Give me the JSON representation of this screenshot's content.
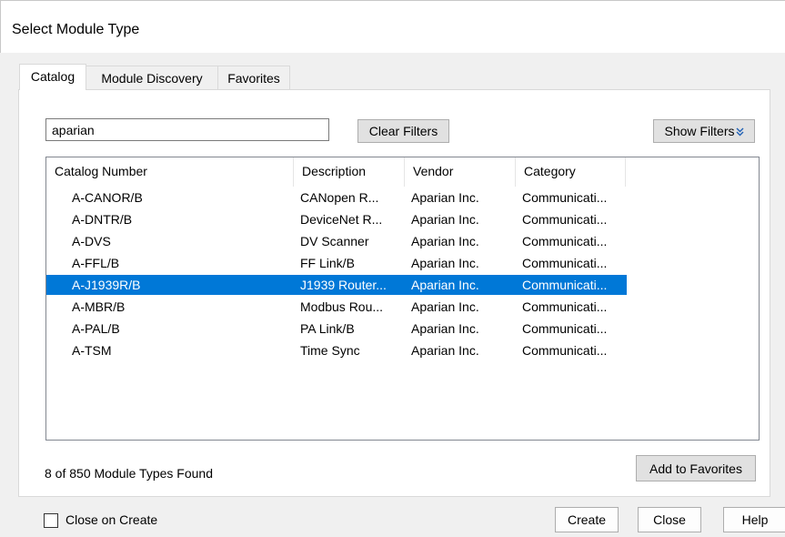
{
  "window": {
    "title": "Select Module Type"
  },
  "tabs": [
    {
      "label": "Catalog",
      "active": true
    },
    {
      "label": "Module Discovery",
      "active": false
    },
    {
      "label": "Favorites",
      "active": false
    }
  ],
  "filters": {
    "search_value": "aparian",
    "clear_filters_label": "Clear Filters",
    "show_filters_label": "Show Filters",
    "show_filters_icon": "double-chevron-down-icon"
  },
  "table": {
    "columns": [
      "Catalog Number",
      "Description",
      "Vendor",
      "Category"
    ],
    "rows": [
      {
        "catalog": "A-CANOR/B",
        "description": "CANopen R...",
        "vendor": "Aparian Inc.",
        "category": "Communicati..."
      },
      {
        "catalog": "A-DNTR/B",
        "description": "DeviceNet R...",
        "vendor": "Aparian Inc.",
        "category": "Communicati..."
      },
      {
        "catalog": "A-DVS",
        "description": "DV Scanner",
        "vendor": "Aparian Inc.",
        "category": "Communicati..."
      },
      {
        "catalog": "A-FFL/B",
        "description": "FF Link/B",
        "vendor": "Aparian Inc.",
        "category": "Communicati..."
      },
      {
        "catalog": "A-J1939R/B",
        "description": "J1939 Router...",
        "vendor": "Aparian Inc.",
        "category": "Communicati..."
      },
      {
        "catalog": "A-MBR/B",
        "description": "Modbus Rou...",
        "vendor": "Aparian Inc.",
        "category": "Communicati..."
      },
      {
        "catalog": "A-PAL/B",
        "description": "PA Link/B",
        "vendor": "Aparian Inc.",
        "category": "Communicati..."
      },
      {
        "catalog": "A-TSM",
        "description": "Time Sync",
        "vendor": "Aparian Inc.",
        "category": "Communicati..."
      }
    ],
    "selected_row_index": 4
  },
  "status_text": "8 of 850 Module Types Found",
  "add_to_favorites_label": "Add to Favorites",
  "footer": {
    "close_on_create_label": "Close on Create",
    "close_on_create_checked": false,
    "create_label": "Create",
    "close_label": "Close",
    "help_label": "Help"
  },
  "colors": {
    "selection": "#0078d7",
    "selection_text": "#ffffff"
  }
}
